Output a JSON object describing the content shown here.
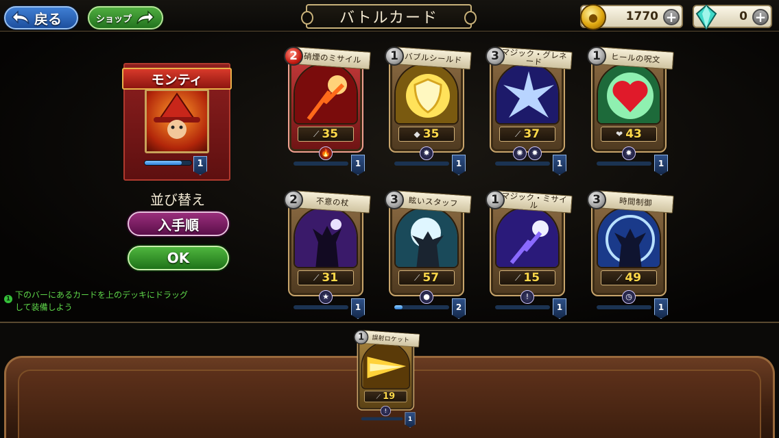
{
  "header": {
    "back_label": "戻る",
    "shop_label": "ショップ",
    "title": "バトルカード",
    "gold": "1770",
    "gems": "0"
  },
  "hero": {
    "name": "モンティ",
    "level": "1",
    "xp_fraction": 0.8
  },
  "sort": {
    "label": "並び替え",
    "button_label": "入手順",
    "ok_label": "OK"
  },
  "hint": {
    "badge": "1",
    "text": "下のバーにあるカードを上のデッキにドラッグして装備しよう"
  },
  "colors": {
    "hint_green": "#5fd84a",
    "stat_yellow": "#ffd94a",
    "accent_red": "#c81e14"
  },
  "cards": [
    {
      "name": "硝煙のミサイル",
      "cost": "2",
      "stat": "35",
      "stat_icon": "sword-icon",
      "level": "1",
      "xp": 0.0,
      "elements": [
        "🔥"
      ],
      "style": "red"
    },
    {
      "name": "バブルシールド",
      "cost": "1",
      "stat": "35",
      "stat_icon": "shield-icon",
      "level": "1",
      "xp": 0.0,
      "elements": [
        "✸"
      ],
      "style": ""
    },
    {
      "name": "マジック・グレネード",
      "cost": "3",
      "stat": "37",
      "stat_icon": "sword-icon",
      "level": "1",
      "xp": 0.0,
      "elements": [
        "✺",
        "✸"
      ],
      "style": ""
    },
    {
      "name": "ヒールの呪文",
      "cost": "1",
      "stat": "43",
      "stat_icon": "heart-icon",
      "level": "1",
      "xp": 0.0,
      "elements": [
        "✸"
      ],
      "style": ""
    },
    {
      "name": "不意の杖",
      "cost": "2",
      "stat": "31",
      "stat_icon": "sword-icon",
      "level": "1",
      "xp": 0.0,
      "elements": [
        "★"
      ],
      "style": ""
    },
    {
      "name": "眩いスタッフ",
      "cost": "3",
      "stat": "57",
      "stat_icon": "sword-icon",
      "level": "2",
      "xp": 0.15,
      "elements": [
        "●"
      ],
      "style": ""
    },
    {
      "name": "マジック・ミサイル",
      "cost": "1",
      "stat": "15",
      "stat_icon": "sword-icon",
      "level": "1",
      "xp": 0.0,
      "elements": [
        "!"
      ],
      "style": ""
    },
    {
      "name": "時間制御",
      "cost": "3",
      "stat": "49",
      "stat_icon": "sword-icon",
      "level": "1",
      "xp": 0.0,
      "elements": [
        "◷"
      ],
      "style": ""
    }
  ],
  "deck_cards": [
    {
      "name": "誤射ロケット",
      "cost": "1",
      "stat": "19",
      "stat_icon": "sword-icon",
      "level": "1",
      "xp": 0.0,
      "elements": [
        "!"
      ],
      "style": "gold"
    }
  ]
}
